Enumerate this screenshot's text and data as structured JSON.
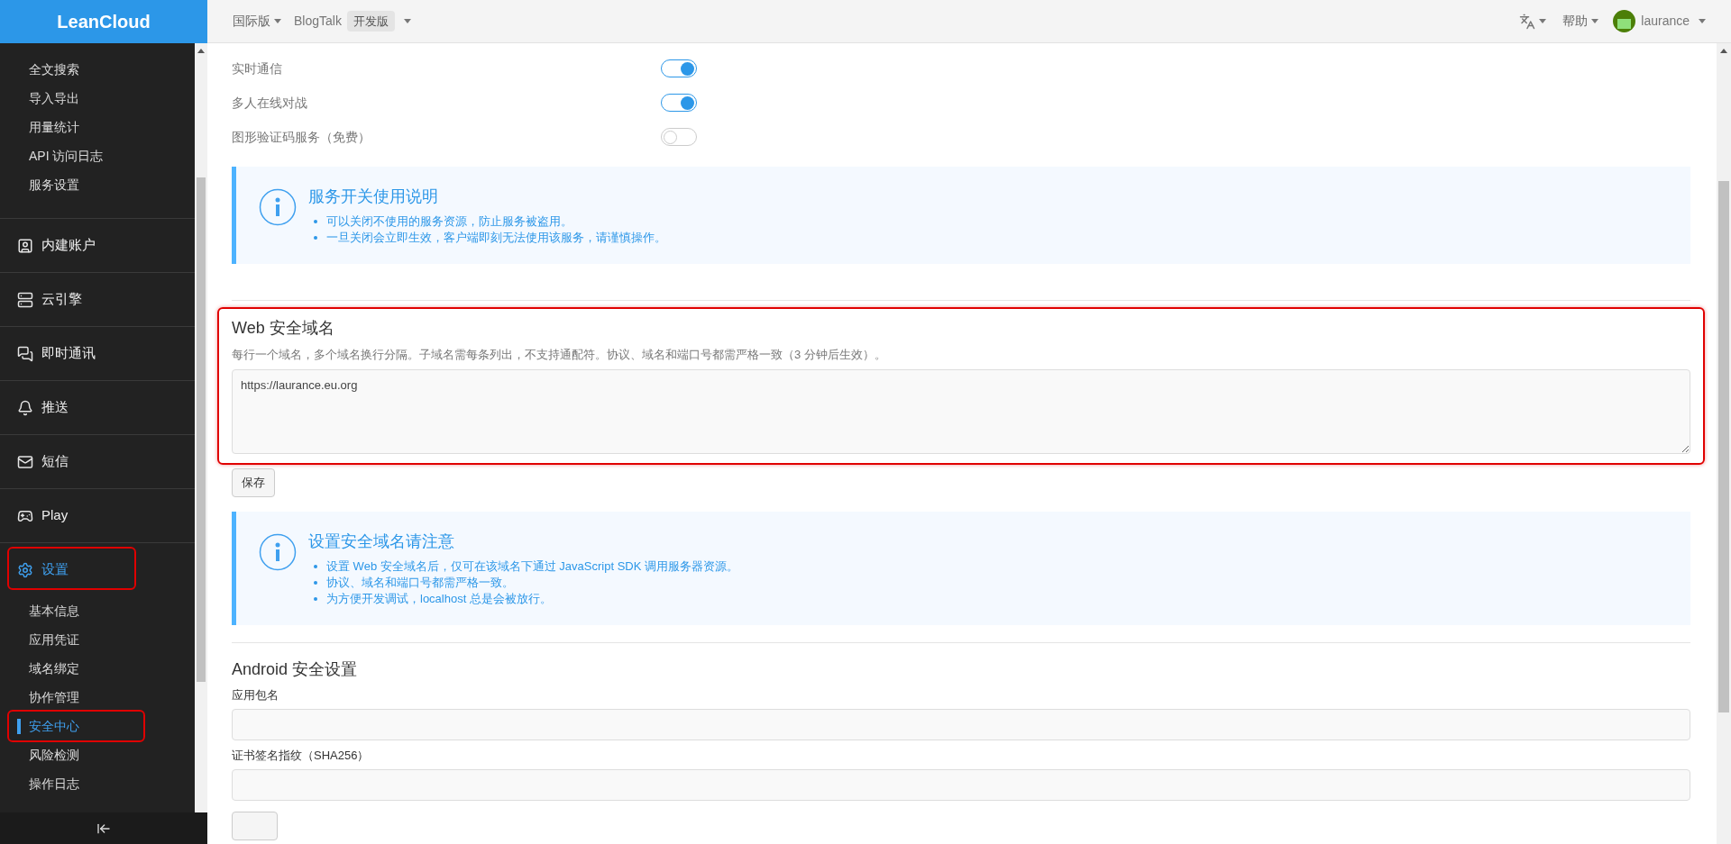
{
  "logo": "LeanCloud",
  "topbar": {
    "region": "国际版",
    "app": "BlogTalk",
    "env_badge": "开发版",
    "help": "帮助",
    "user": "laurance"
  },
  "sidebar": {
    "top_items": [
      {
        "label": "全文搜索",
        "selected": false
      },
      {
        "label": "导入导出",
        "selected": false
      },
      {
        "label": "用量统计",
        "selected": false
      },
      {
        "label": "API 访问日志",
        "selected": false
      },
      {
        "label": "服务设置",
        "selected": false
      }
    ],
    "sections": [
      {
        "label": "内建账户",
        "selected": false
      },
      {
        "label": "云引擎",
        "selected": false
      },
      {
        "label": "即时通讯",
        "selected": false
      },
      {
        "label": "推送",
        "selected": false
      },
      {
        "label": "短信",
        "selected": false
      },
      {
        "label": "Play",
        "selected": false
      },
      {
        "label": "设置",
        "selected": true,
        "highlighted": true,
        "children": [
          {
            "label": "基本信息",
            "selected": false
          },
          {
            "label": "应用凭证",
            "selected": false
          },
          {
            "label": "域名绑定",
            "selected": false
          },
          {
            "label": "协作管理",
            "selected": false
          },
          {
            "label": "安全中心",
            "selected": true,
            "highlighted": true
          },
          {
            "label": "风险检测",
            "selected": false
          },
          {
            "label": "操作日志",
            "selected": false
          }
        ]
      }
    ]
  },
  "services": [
    {
      "label": "实时通信",
      "on": true
    },
    {
      "label": "多人在线对战",
      "on": true
    },
    {
      "label": "图形验证码服务（免费）",
      "on": false
    }
  ],
  "service_notice": {
    "title": "服务开关使用说明",
    "items": [
      "可以关闭不使用的服务资源，防止服务被盗用。",
      "一旦关闭会立即生效，客户端即刻无法使用该服务，请谨慎操作。"
    ]
  },
  "web_domains": {
    "title": "Web 安全域名",
    "highlighted": true,
    "description": "每行一个域名，多个域名换行分隔。子域名需每条列出，不支持通配符。协议、域名和端口号都需严格一致（3 分钟后生效）。",
    "value": "https://laurance.eu.org",
    "button": "保存"
  },
  "domain_notice": {
    "title": "设置安全域名请注意",
    "items": [
      "设置 Web 安全域名后，仅可在该域名下通过 JavaScript SDK 调用服务器资源。",
      "协议、域名和端口号都需严格一致。",
      "为方便开发调试，localhost 总是会被放行。"
    ]
  },
  "android": {
    "title": "Android 安全设置",
    "fields": [
      {
        "label": "应用包名"
      },
      {
        "label": "证书签名指纹（SHA256）"
      }
    ]
  }
}
